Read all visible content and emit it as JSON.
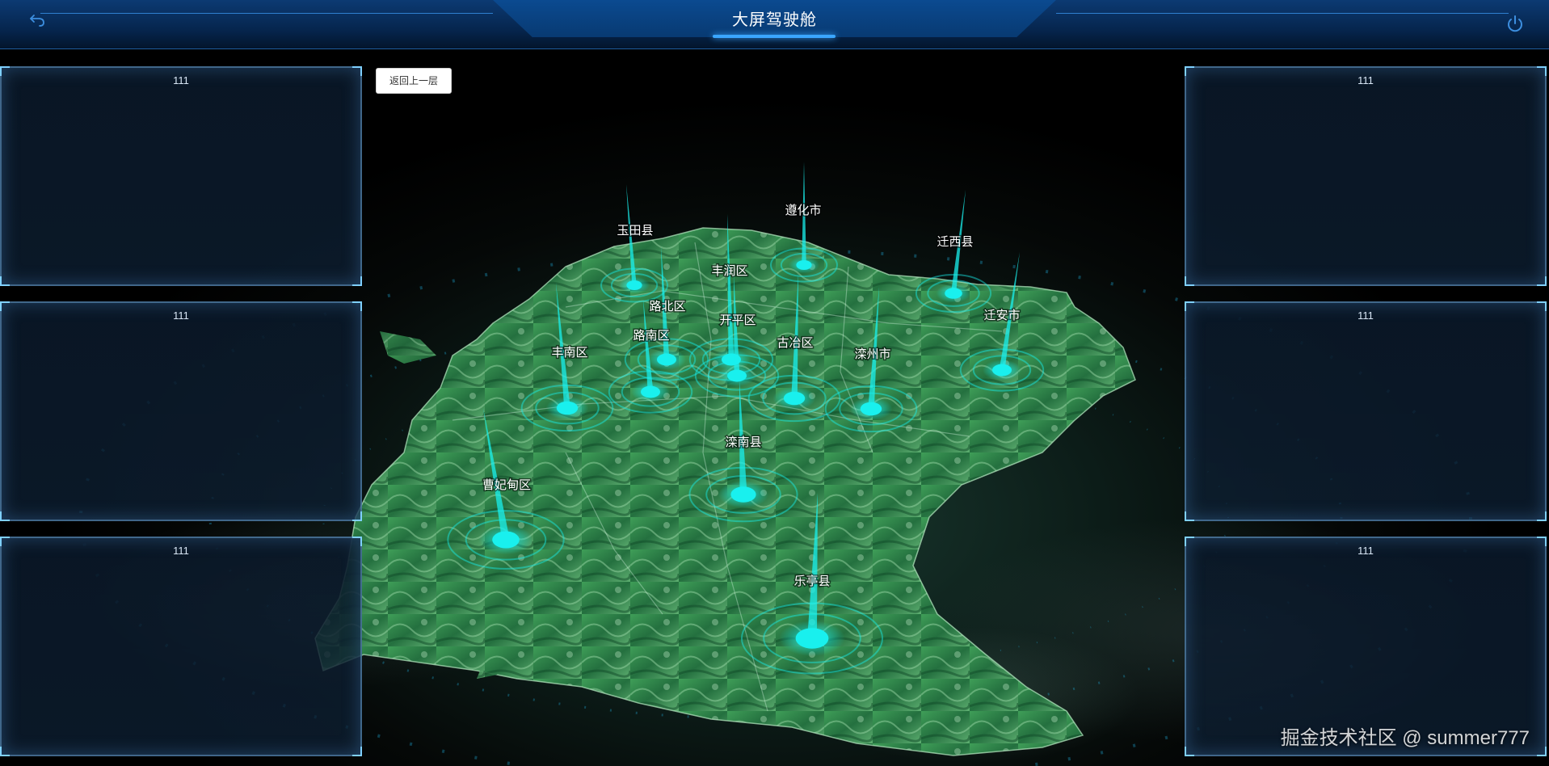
{
  "header": {
    "title": "大屏驾驶舱",
    "back_icon": "undo-arrow-icon",
    "power_icon": "power-icon"
  },
  "back_button_label": "返回上一层",
  "panels": {
    "left": [
      {
        "title": "111"
      },
      {
        "title": "111"
      },
      {
        "title": "111"
      }
    ],
    "right": [
      {
        "title": "111"
      },
      {
        "title": "111"
      },
      {
        "title": "111"
      }
    ]
  },
  "map": {
    "districts": [
      {
        "name": "遵化市"
      },
      {
        "name": "玉田县"
      },
      {
        "name": "迁西县"
      },
      {
        "name": "丰润区"
      },
      {
        "name": "路北区"
      },
      {
        "name": "开平区"
      },
      {
        "name": "迁安市"
      },
      {
        "name": "丰南区"
      },
      {
        "name": "路南区"
      },
      {
        "name": "古冶区"
      },
      {
        "name": "滦州市"
      },
      {
        "name": "滦南县"
      },
      {
        "name": "曹妃甸区"
      },
      {
        "name": "乐亭县"
      }
    ]
  },
  "colors": {
    "marker": "#19f0ee",
    "header_bg": "#0c3a73",
    "panel_border": "#6eaadc",
    "map_green": "#2c8a4a"
  },
  "watermark": "掘金技术社区 @ summer777"
}
